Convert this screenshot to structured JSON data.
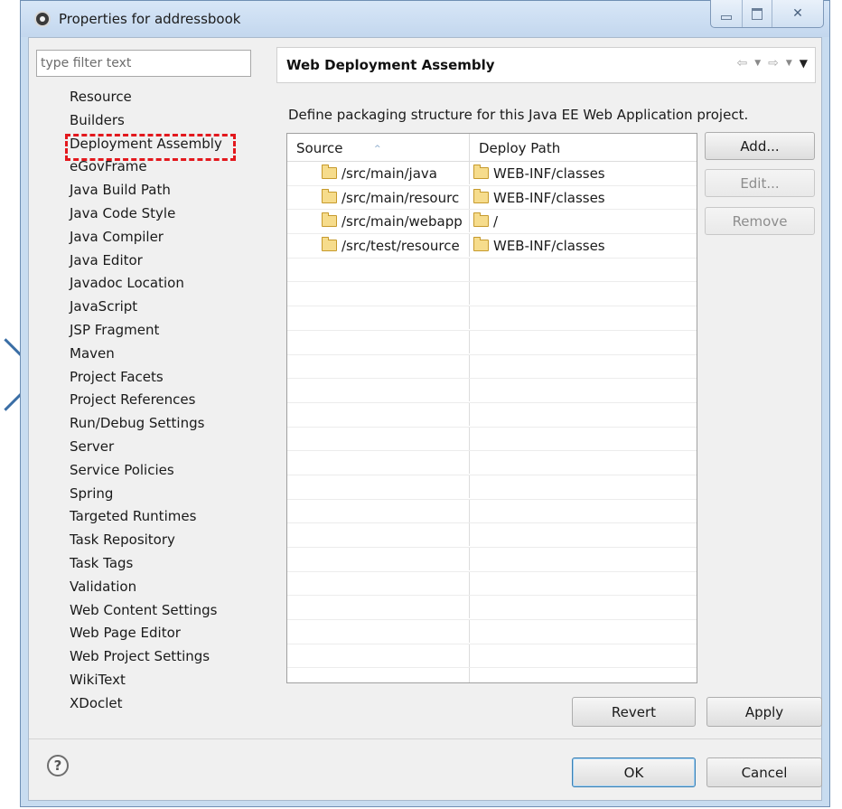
{
  "window": {
    "title": "Properties for addressbook"
  },
  "filter": {
    "placeholder": "type filter text",
    "value": ""
  },
  "nav": {
    "items": [
      "Resource",
      "Builders",
      "Deployment Assembly",
      "eGovFrame",
      "Java Build Path",
      "Java Code Style",
      "Java Compiler",
      "Java Editor",
      "Javadoc Location",
      "JavaScript",
      "JSP Fragment",
      "Maven",
      "Project Facets",
      "Project References",
      "Run/Debug Settings",
      "Server",
      "Service Policies",
      "Spring",
      "Targeted Runtimes",
      "Task Repository",
      "Task Tags",
      "Validation",
      "Web Content Settings",
      "Web Page Editor",
      "Web Project Settings",
      "WikiText",
      "XDoclet"
    ],
    "highlighted_index": 2,
    "highlight_color": "#e3181d"
  },
  "page": {
    "title": "Web Deployment Assembly",
    "nav_back_glyph": "⇦",
    "nav_forward_glyph": "⇨",
    "description": "Define packaging structure for this Java EE Web Application project."
  },
  "table": {
    "columns": [
      "Source",
      "Deploy Path"
    ],
    "sort_indicator": "^",
    "rows": [
      {
        "source": "/src/main/java",
        "deploy_path": "WEB-INF/classes"
      },
      {
        "source": "/src/main/resourc",
        "deploy_path": "WEB-INF/classes"
      },
      {
        "source": "/src/main/webapp",
        "deploy_path": "/"
      },
      {
        "source": "/src/test/resource",
        "deploy_path": "WEB-INF/classes"
      }
    ],
    "total_visible_rows": 22
  },
  "buttons": {
    "add": "Add...",
    "edit": "Edit...",
    "remove": "Remove",
    "revert": "Revert",
    "apply": "Apply",
    "ok": "OK",
    "cancel": "Cancel"
  },
  "icons": {
    "help": "?",
    "close": "✕"
  }
}
